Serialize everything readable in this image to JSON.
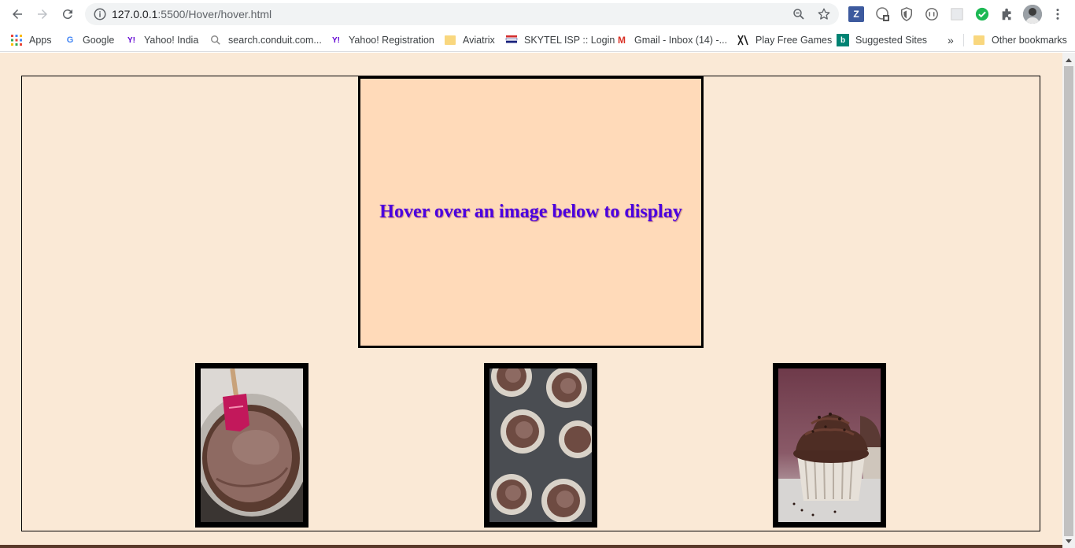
{
  "browser": {
    "url_host": "127.0.0.1",
    "url_path": ":5500/Hover/hover.html",
    "extensions": [
      "z-extension-icon",
      "translate-extension-icon",
      "shield-extension-icon",
      "sync-extension-icon",
      "grid-extension-icon",
      "check-extension-icon",
      "puzzle-icon",
      "avatar"
    ]
  },
  "bookmarks": {
    "items": [
      {
        "label": "Apps",
        "icon": "apps-grid-icon"
      },
      {
        "label": "Google",
        "icon": "google-icon"
      },
      {
        "label": "Yahoo! India",
        "icon": "yahoo-icon"
      },
      {
        "label": "search.conduit.com...",
        "icon": "search-icon"
      },
      {
        "label": "Yahoo! Registration",
        "icon": "yahoo-icon"
      },
      {
        "label": "Aviatrix",
        "icon": "folder-icon"
      },
      {
        "label": "SKYTEL ISP :: Login",
        "icon": "skytel-icon"
      },
      {
        "label": "Gmail - Inbox (14) -...",
        "icon": "gmail-icon"
      },
      {
        "label": "Play Free Games",
        "icon": "games-icon"
      },
      {
        "label": "Suggested Sites",
        "icon": "bing-icon"
      }
    ],
    "overflow": "»",
    "other": "Other bookmarks"
  },
  "page": {
    "display_text": "Hover over an image below to display",
    "thumbnails": [
      {
        "name": "chocolate-batter-bowl"
      },
      {
        "name": "cupcake-tin"
      },
      {
        "name": "frosted-cupcake"
      }
    ],
    "colors": {
      "background": "#fae9d6",
      "display_bg": "#ffdab9",
      "text": "#4b00e0"
    }
  }
}
